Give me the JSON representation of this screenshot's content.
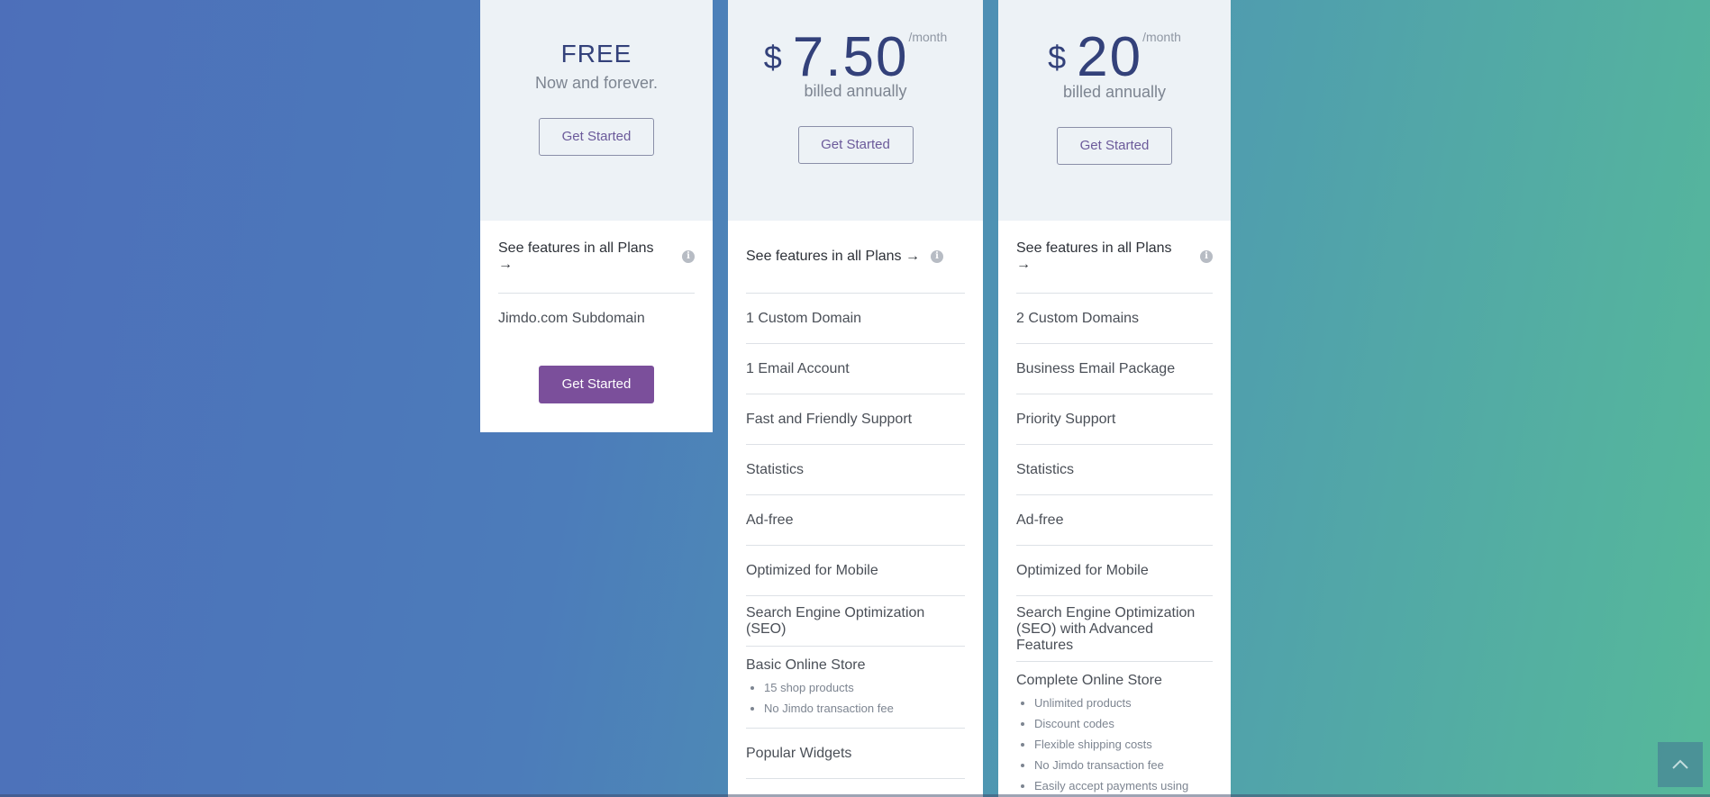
{
  "plans": {
    "free": {
      "title": "FREE",
      "subtitle": "Now and forever.",
      "get_started_top": "Get Started",
      "see_features": "See features in all Plans →",
      "features": [
        "Jimdo.com Subdomain"
      ],
      "get_started_bottom": "Get Started"
    },
    "mid": {
      "currency": "$",
      "amount": "7.50",
      "period": "/month",
      "billing": "billed annually",
      "get_started_top": "Get Started",
      "see_features": "See features in all Plans →",
      "features": [
        "1 Custom Domain",
        "1 Email Account",
        "Fast and Friendly Support",
        "Statistics",
        "Ad-free",
        "Optimized for Mobile",
        "Search Engine Optimization (SEO)"
      ],
      "store": {
        "label": "Basic Online Store",
        "items": [
          "15 shop products",
          "No Jimdo transaction fee"
        ]
      },
      "extra": "Popular Widgets"
    },
    "pro": {
      "currency": "$",
      "amount": "20",
      "period": "/month",
      "billing": "billed annually",
      "get_started_top": "Get Started",
      "see_features": "See features in all Plans →",
      "features": [
        "2 Custom Domains",
        "Business Email Package",
        "Priority Support",
        "Statistics",
        "Ad-free",
        "Optimized for Mobile"
      ],
      "seo": "Search Engine Optimization (SEO) with Advanced Features",
      "store": {
        "label": "Complete Online Store",
        "items": [
          "Unlimited products",
          "Discount codes",
          "Flexible shipping costs",
          "No Jimdo transaction fee",
          "Easily accept payments using PayPal"
        ]
      }
    }
  },
  "icons": {
    "info": "info-icon",
    "scroll_top": "chevron-up-icon"
  },
  "colors": {
    "accent": "#7b4f9b",
    "price": "#33417a",
    "card_head": "#edf2f6"
  }
}
